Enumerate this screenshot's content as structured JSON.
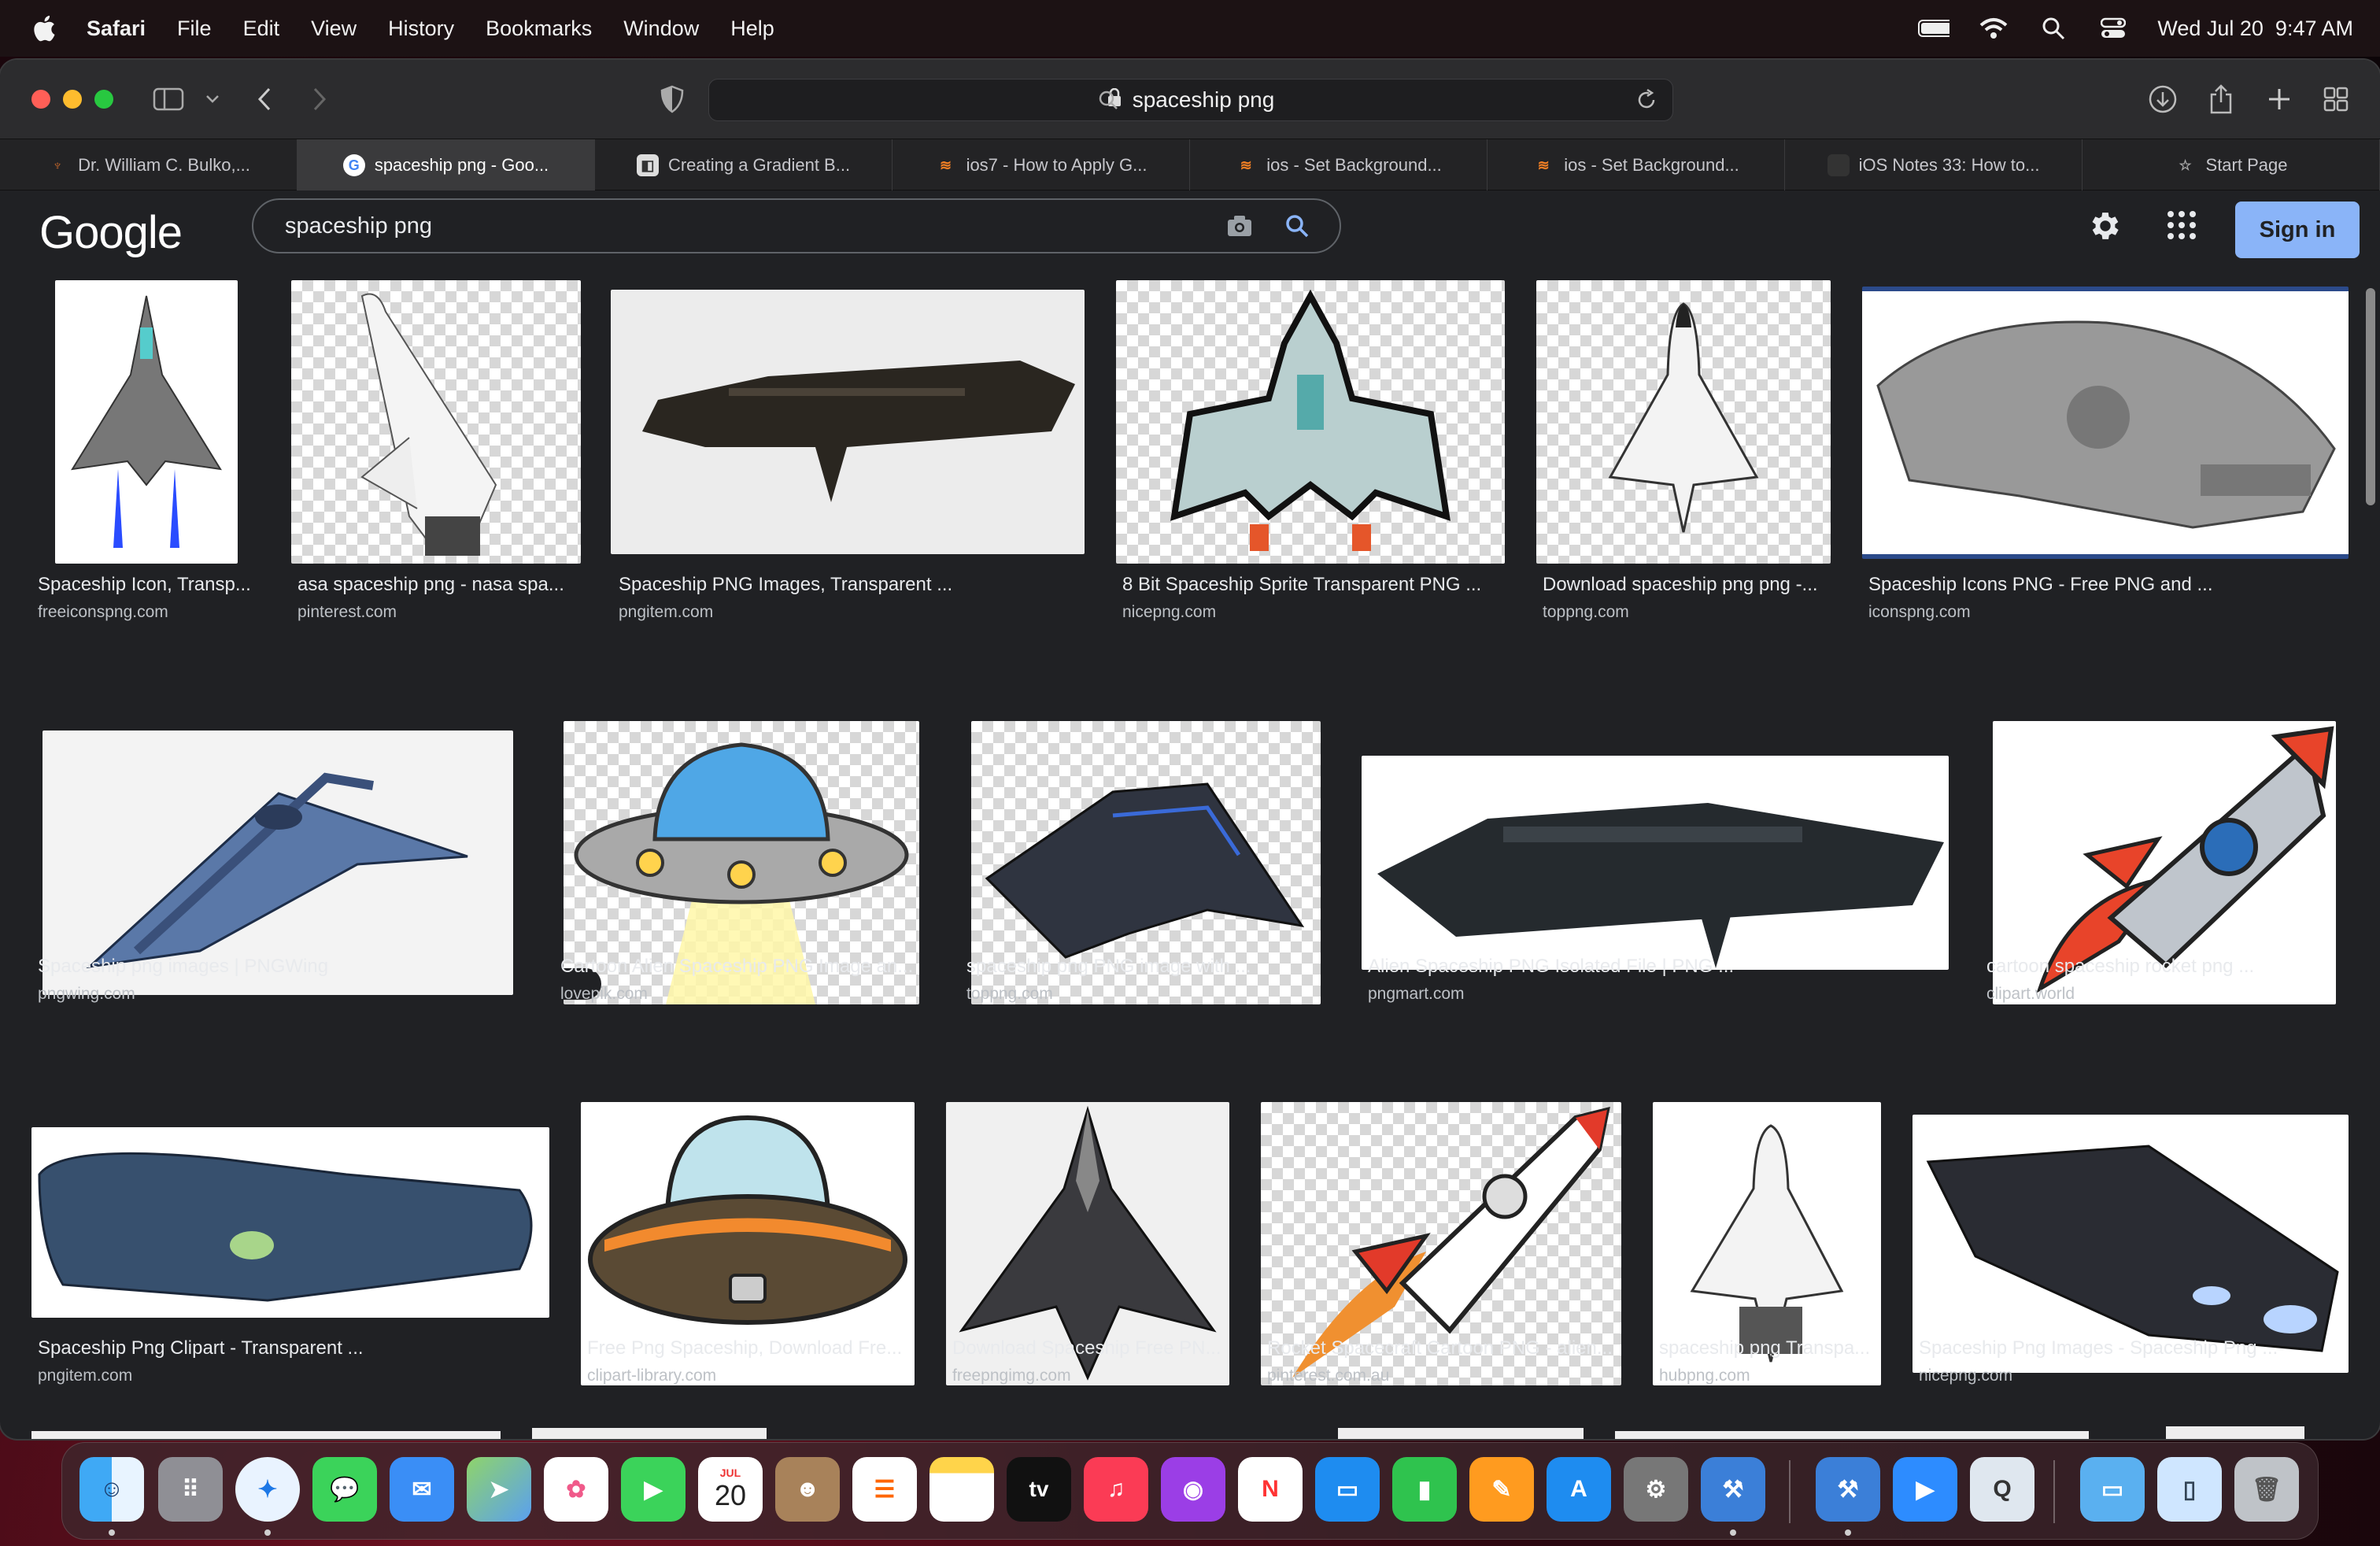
{
  "menubar": {
    "app": "Safari",
    "items": [
      "File",
      "Edit",
      "View",
      "History",
      "Bookmarks",
      "Window",
      "Help"
    ],
    "clock": "Wed Jul 20  9:47 AM"
  },
  "browser": {
    "address": "spaceship png",
    "tabs": [
      {
        "label": "Dr. William C. Bulko,...",
        "icon": "generic-favicon",
        "active": false
      },
      {
        "label": "spaceship png - Goo...",
        "icon": "google-favicon",
        "active": true
      },
      {
        "label": "Creating a Gradient B...",
        "icon": "generic-favicon",
        "active": false
      },
      {
        "label": "ios7 - How to Apply G...",
        "icon": "stackoverflow-favicon",
        "active": false
      },
      {
        "label": "ios - Set Background...",
        "icon": "stackoverflow-favicon",
        "active": false
      },
      {
        "label": "ios - Set Background...",
        "icon": "stackoverflow-favicon",
        "active": false
      },
      {
        "label": "iOS Notes 33: How to...",
        "icon": "generic-favicon",
        "active": false
      },
      {
        "label": "Start Page",
        "icon": "star-icon",
        "active": false
      }
    ]
  },
  "google": {
    "logo": "Google",
    "query": "spaceship png",
    "signin": "Sign in"
  },
  "results": [
    {
      "title": "Spaceship Icon, Transp...",
      "source": "freeiconspng.com"
    },
    {
      "title": "asa spaceship png - nasa spa...",
      "source": "pinterest.com"
    },
    {
      "title": "Spaceship PNG Images, Transparent ...",
      "source": "pngitem.com"
    },
    {
      "title": "8 Bit Spaceship Sprite Transparent PNG ...",
      "source": "nicepng.com"
    },
    {
      "title": "Download spaceship png png -...",
      "source": "toppng.com"
    },
    {
      "title": "Spaceship Icons PNG - Free PNG and ...",
      "source": "iconspng.com"
    },
    {
      "title": "Spaceship png images | PNGWing",
      "source": "pngwing.com"
    },
    {
      "title": "Cartoon Alien Spaceship PNG Image an...",
      "source": "lovepik.com"
    },
    {
      "title": "spaceship png PNG image with ...",
      "source": "toppng.com"
    },
    {
      "title": "Alien Spaceship PNG Isolated File | PNG ...",
      "source": "pngmart.com"
    },
    {
      "title": "cartoon spaceship rocket png ...",
      "source": "clipart.world"
    },
    {
      "title": "Spaceship Png Clipart - Transparent ...",
      "source": "pngitem.com"
    },
    {
      "title": "Free Png Spaceship, Download Fre...",
      "source": "clipart-library.com"
    },
    {
      "title": "Download Spaceship Free PN...",
      "source": "freepngimg.com"
    },
    {
      "title": "Rocket Spacecraft Cartoon PNG - alien...",
      "source": "pinterest.com.au"
    },
    {
      "title": "spaceship png Transpa...",
      "source": "hubpng.com"
    },
    {
      "title": "Spaceship Png Images - Spaceship Png ...",
      "source": "nicepng.com"
    }
  ],
  "dock": {
    "calendar_month": "JUL",
    "calendar_day": "20",
    "tv_label": "tv",
    "apps": [
      "Finder",
      "Launchpad",
      "Safari",
      "Messages",
      "Mail",
      "Maps",
      "Photos",
      "FaceTime",
      "Calendar",
      "Contacts",
      "Reminders",
      "Notes",
      "TV",
      "Music",
      "Podcasts",
      "News",
      "Keynote",
      "Numbers",
      "Pages",
      "App Store",
      "System Preferences",
      "Xcode",
      "Simulator",
      "Zoom",
      "Proxyman",
      "Downloads",
      "Preview",
      "Trash"
    ]
  },
  "colors": {
    "accent": "#8ab4f8",
    "page_bg": "#202124"
  }
}
